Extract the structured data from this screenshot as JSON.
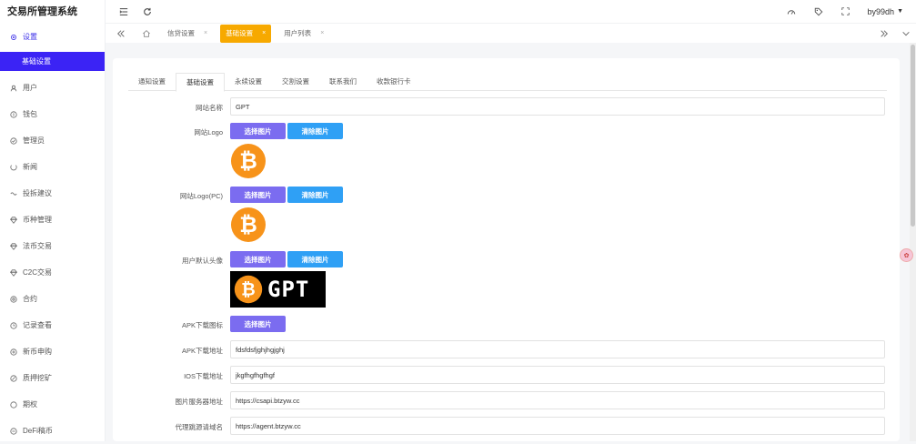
{
  "app_title": "交易所管理系统",
  "sidebar": {
    "items": [
      {
        "label": "设置",
        "icon": "gear-icon"
      },
      {
        "label": "基础设置"
      },
      {
        "label": "用户",
        "icon": "user-icon"
      },
      {
        "label": "钱包",
        "icon": "wallet-icon"
      },
      {
        "label": "管理员",
        "icon": "admin-icon"
      },
      {
        "label": "新闻",
        "icon": "news-icon"
      },
      {
        "label": "投拆建议",
        "icon": "feedback-icon"
      },
      {
        "label": "币种管理",
        "icon": "coin-icon"
      },
      {
        "label": "法币交易",
        "icon": "fiat-icon"
      },
      {
        "label": "C2C交易",
        "icon": "c2c-icon"
      },
      {
        "label": "合约",
        "icon": "contract-icon"
      },
      {
        "label": "记录查看",
        "icon": "record-icon"
      },
      {
        "label": "新币申购",
        "icon": "newcoin-icon"
      },
      {
        "label": "质押挖矿",
        "icon": "mining-icon"
      },
      {
        "label": "期权",
        "icon": "option-icon"
      },
      {
        "label": "DeFi稿币",
        "icon": "defi-icon"
      }
    ]
  },
  "topbar": {
    "username": "by99dh"
  },
  "page_tabs": [
    {
      "label": "信贷设置",
      "active": false
    },
    {
      "label": "基础设置",
      "active": true
    },
    {
      "label": "用户列表",
      "active": false
    }
  ],
  "form_tabs": [
    {
      "label": "通知设置"
    },
    {
      "label": "基础设置",
      "active": true
    },
    {
      "label": "永续设置"
    },
    {
      "label": "交割设置"
    },
    {
      "label": "联系我们"
    },
    {
      "label": "收款银行卡"
    }
  ],
  "buttons": {
    "choose": "选择图片",
    "clear": "清除图片"
  },
  "fields": {
    "site_name": {
      "label": "网站名称",
      "value": "GPT"
    },
    "site_logo": {
      "label": "网站Logo"
    },
    "site_logo_pc": {
      "label": "网站Logo(PC)"
    },
    "default_avatar": {
      "label": "用户默认头像",
      "banner_text": "GPT"
    },
    "apk_icon": {
      "label": "APK下载图标"
    },
    "apk_url": {
      "label": "APK下载地址",
      "value": "fdsfdsfjghjhgjghj"
    },
    "ios_url": {
      "label": "IOS下载地址",
      "value": "jkgfhgfhgfhgf"
    },
    "image_server": {
      "label": "图片服务器地址",
      "value": "https://csapi.btzyw.cc"
    },
    "agent_domain": {
      "label": "代理跳源请域名",
      "value": "https://agent.btzyw.cc"
    }
  },
  "colors": {
    "accent": "#3b23f5",
    "tab_active": "#f7a900",
    "btn_purple": "#7b6cf0",
    "btn_blue": "#2fa0f5",
    "bitcoin": "#f7931a"
  }
}
